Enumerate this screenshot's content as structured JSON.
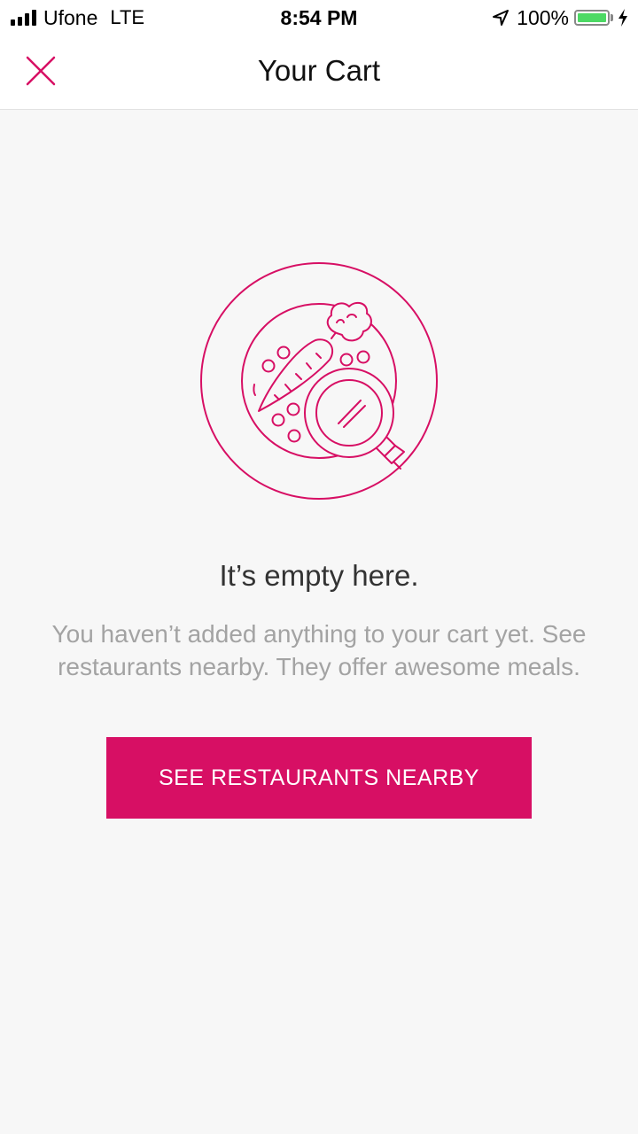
{
  "status_bar": {
    "carrier": "Ufone",
    "network": "LTE",
    "time": "8:54 PM",
    "battery": "100%",
    "icons": [
      "signal-icon",
      "location-arrow-icon",
      "battery-icon",
      "charging-icon"
    ]
  },
  "header": {
    "title": "Your Cart",
    "close_icon": "close-icon"
  },
  "empty_state": {
    "illustration": "plate-magnifier-icon",
    "title": "It’s empty here.",
    "description": "You haven’t added anything to your cart yet. See restaurants nearby. They offer awesome meals.",
    "button_label": "SEE RESTAURANTS NEARBY"
  },
  "colors": {
    "accent": "#d70f64",
    "background": "#f7f7f7",
    "battery": "#4cd964"
  }
}
